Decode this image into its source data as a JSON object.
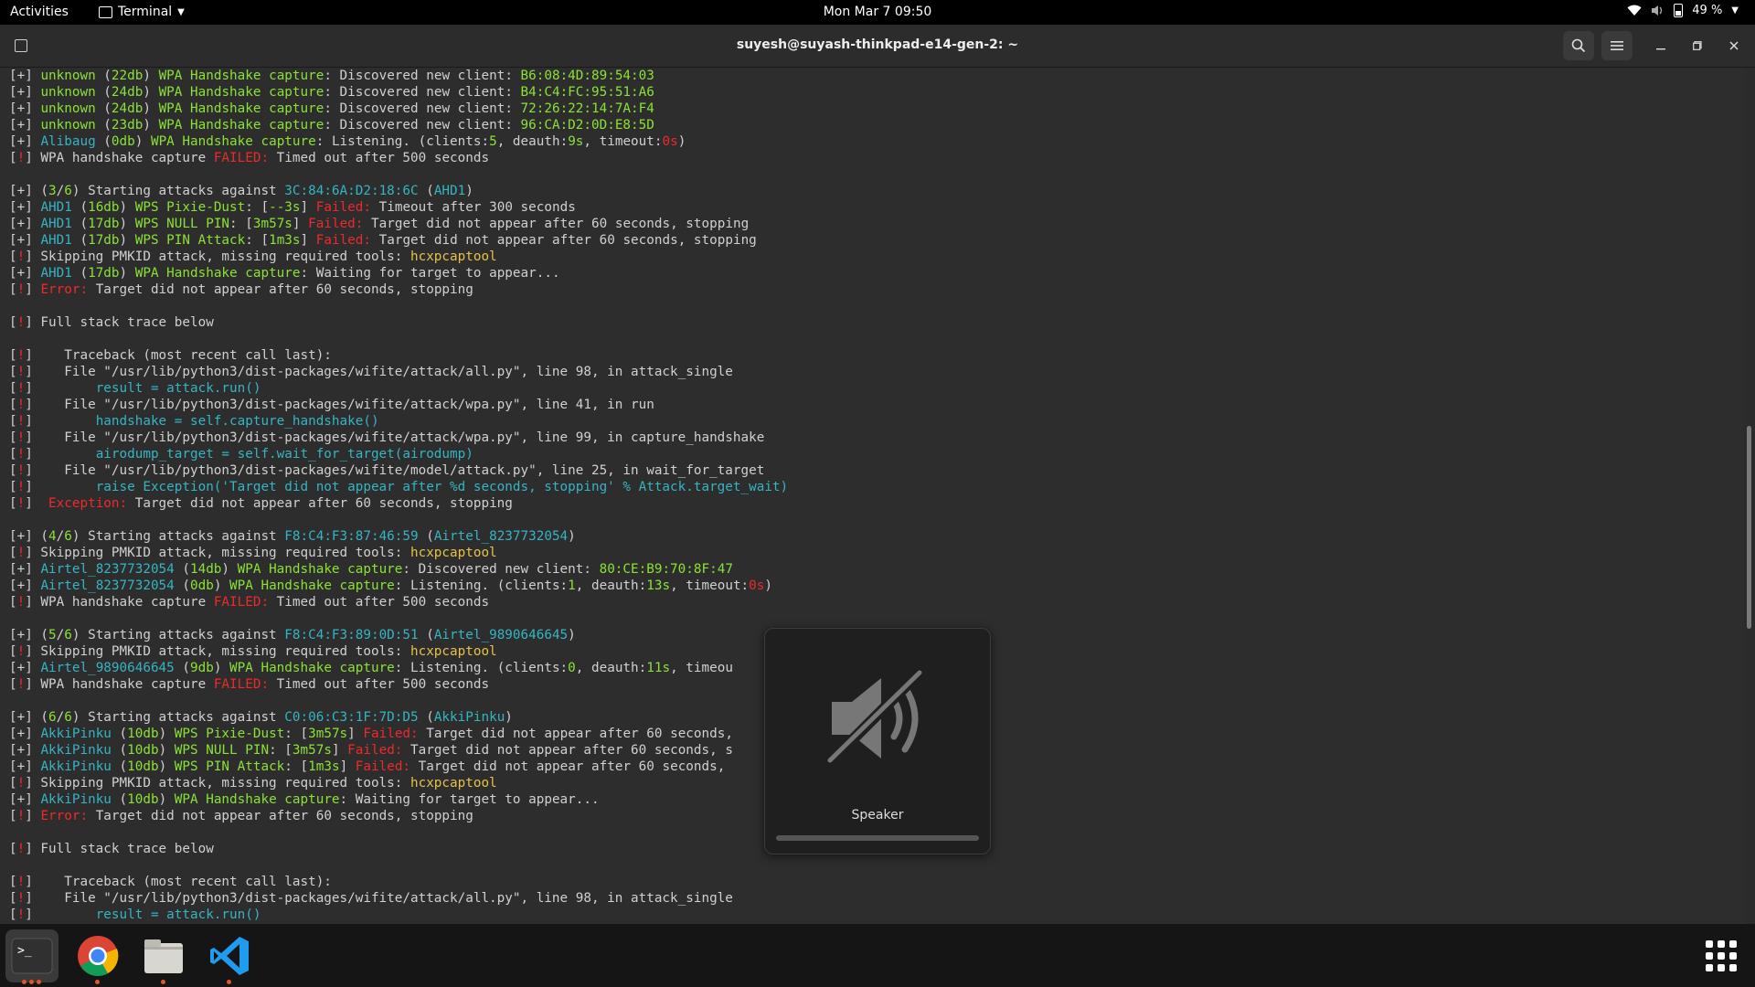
{
  "topbar": {
    "activities": "Activities",
    "app_name": "Terminal",
    "clock": "Mon Mar 7  09:50",
    "battery": "49 %"
  },
  "window": {
    "title": "suyesh@suyash-thinkpad-e14-gen-2: ~"
  },
  "terminal_lines": [
    [
      [
        "w",
        "[+] "
      ],
      [
        "g",
        "unknown"
      ],
      [
        "w",
        " ("
      ],
      [
        "g",
        "22db"
      ],
      [
        "w",
        ") "
      ],
      [
        "g",
        "WPA Handshake capture"
      ],
      [
        "w",
        ": Discovered new client: "
      ],
      [
        "g",
        "B6:08:4D:89:54:03"
      ]
    ],
    [
      [
        "w",
        "[+] "
      ],
      [
        "g",
        "unknown"
      ],
      [
        "w",
        " ("
      ],
      [
        "g",
        "24db"
      ],
      [
        "w",
        ") "
      ],
      [
        "g",
        "WPA Handshake capture"
      ],
      [
        "w",
        ": Discovered new client: "
      ],
      [
        "g",
        "B4:C4:FC:95:51:A6"
      ]
    ],
    [
      [
        "w",
        "[+] "
      ],
      [
        "g",
        "unknown"
      ],
      [
        "w",
        " ("
      ],
      [
        "g",
        "24db"
      ],
      [
        "w",
        ") "
      ],
      [
        "g",
        "WPA Handshake capture"
      ],
      [
        "w",
        ": Discovered new client: "
      ],
      [
        "g",
        "72:26:22:14:7A:F4"
      ]
    ],
    [
      [
        "w",
        "[+] "
      ],
      [
        "g",
        "unknown"
      ],
      [
        "w",
        " ("
      ],
      [
        "g",
        "23db"
      ],
      [
        "w",
        ") "
      ],
      [
        "g",
        "WPA Handshake capture"
      ],
      [
        "w",
        ": Discovered new client: "
      ],
      [
        "g",
        "96:CA:D2:0D:E8:5D"
      ]
    ],
    [
      [
        "w",
        "[+] "
      ],
      [
        "c",
        "Alibaug"
      ],
      [
        "w",
        " ("
      ],
      [
        "g",
        "0db"
      ],
      [
        "w",
        ") "
      ],
      [
        "g",
        "WPA Handshake capture"
      ],
      [
        "w",
        ": Listening. (clients:"
      ],
      [
        "g",
        "5"
      ],
      [
        "w",
        ", deauth:"
      ],
      [
        "g",
        "9s"
      ],
      [
        "w",
        ", timeout:"
      ],
      [
        "r",
        "0s"
      ],
      [
        "w",
        ")"
      ]
    ],
    [
      [
        "w",
        "["
      ],
      [
        "r",
        "!"
      ],
      [
        "w",
        "] WPA handshake capture "
      ],
      [
        "r",
        "FAILED:"
      ],
      [
        "w",
        " Timed out after 500 seconds"
      ]
    ],
    [
      [
        "w",
        ""
      ]
    ],
    [
      [
        "w",
        "[+] ("
      ],
      [
        "g",
        "3"
      ],
      [
        "w",
        "/"
      ],
      [
        "g",
        "6"
      ],
      [
        "w",
        ") Starting attacks against "
      ],
      [
        "c",
        "3C:84:6A:D2:18:6C"
      ],
      [
        "w",
        " ("
      ],
      [
        "c",
        "AHD1"
      ],
      [
        "w",
        ")"
      ]
    ],
    [
      [
        "w",
        "[+] "
      ],
      [
        "c",
        "AHD1"
      ],
      [
        "w",
        " ("
      ],
      [
        "g",
        "16db"
      ],
      [
        "w",
        ") "
      ],
      [
        "g",
        "WPS Pixie-Dust"
      ],
      [
        "w",
        ": ["
      ],
      [
        "g",
        "--3s"
      ],
      [
        "w",
        "] "
      ],
      [
        "r",
        "Failed:"
      ],
      [
        "w",
        " Timeout after 300 seconds"
      ]
    ],
    [
      [
        "w",
        "[+] "
      ],
      [
        "c",
        "AHD1"
      ],
      [
        "w",
        " ("
      ],
      [
        "g",
        "17db"
      ],
      [
        "w",
        ") "
      ],
      [
        "g",
        "WPS NULL PIN"
      ],
      [
        "w",
        ": ["
      ],
      [
        "g",
        "3m57s"
      ],
      [
        "w",
        "] "
      ],
      [
        "r",
        "Failed:"
      ],
      [
        "w",
        " Target did not appear after 60 seconds, stopping"
      ]
    ],
    [
      [
        "w",
        "[+] "
      ],
      [
        "c",
        "AHD1"
      ],
      [
        "w",
        " ("
      ],
      [
        "g",
        "17db"
      ],
      [
        "w",
        ") "
      ],
      [
        "g",
        "WPS PIN Attack"
      ],
      [
        "w",
        ": ["
      ],
      [
        "g",
        "1m3s"
      ],
      [
        "w",
        "] "
      ],
      [
        "r",
        "Failed:"
      ],
      [
        "w",
        " Target did not appear after 60 seconds, stopping"
      ]
    ],
    [
      [
        "w",
        "["
      ],
      [
        "r",
        "!"
      ],
      [
        "w",
        "] Skipping PMKID attack, missing required tools: "
      ],
      [
        "y",
        "hcxpcaptool"
      ]
    ],
    [
      [
        "w",
        "[+] "
      ],
      [
        "c",
        "AHD1"
      ],
      [
        "w",
        " ("
      ],
      [
        "g",
        "17db"
      ],
      [
        "w",
        ") "
      ],
      [
        "g",
        "WPA Handshake capture"
      ],
      [
        "w",
        ": Waiting for target to appear..."
      ]
    ],
    [
      [
        "w",
        "["
      ],
      [
        "r",
        "!"
      ],
      [
        "w",
        "] "
      ],
      [
        "r",
        "Error:"
      ],
      [
        "w",
        " Target did not appear after 60 seconds, stopping"
      ]
    ],
    [
      [
        "w",
        ""
      ]
    ],
    [
      [
        "w",
        "["
      ],
      [
        "r",
        "!"
      ],
      [
        "w",
        "] Full stack trace below"
      ]
    ],
    [
      [
        "w",
        ""
      ]
    ],
    [
      [
        "w",
        "["
      ],
      [
        "r",
        "!"
      ],
      [
        "w",
        "]    Traceback (most recent call last):"
      ]
    ],
    [
      [
        "w",
        "["
      ],
      [
        "r",
        "!"
      ],
      [
        "w",
        "]    File \"/usr/lib/python3/dist-packages/wifite/attack/all.py\", line 98, in attack_single"
      ]
    ],
    [
      [
        "w",
        "["
      ],
      [
        "r",
        "!"
      ],
      [
        "w",
        "]        "
      ],
      [
        "c",
        "result = attack.run()"
      ]
    ],
    [
      [
        "w",
        "["
      ],
      [
        "r",
        "!"
      ],
      [
        "w",
        "]    File \"/usr/lib/python3/dist-packages/wifite/attack/wpa.py\", line 41, in run"
      ]
    ],
    [
      [
        "w",
        "["
      ],
      [
        "r",
        "!"
      ],
      [
        "w",
        "]        "
      ],
      [
        "c",
        "handshake = self.capture_handshake()"
      ]
    ],
    [
      [
        "w",
        "["
      ],
      [
        "r",
        "!"
      ],
      [
        "w",
        "]    File \"/usr/lib/python3/dist-packages/wifite/attack/wpa.py\", line 99, in capture_handshake"
      ]
    ],
    [
      [
        "w",
        "["
      ],
      [
        "r",
        "!"
      ],
      [
        "w",
        "]        "
      ],
      [
        "c",
        "airodump_target = self.wait_for_target(airodump)"
      ]
    ],
    [
      [
        "w",
        "["
      ],
      [
        "r",
        "!"
      ],
      [
        "w",
        "]    File \"/usr/lib/python3/dist-packages/wifite/model/attack.py\", line 25, in wait_for_target"
      ]
    ],
    [
      [
        "w",
        "["
      ],
      [
        "r",
        "!"
      ],
      [
        "w",
        "]        "
      ],
      [
        "c",
        "raise Exception('Target did not appear after %d seconds, stopping' % Attack.target_wait)"
      ]
    ],
    [
      [
        "w",
        "["
      ],
      [
        "r",
        "!"
      ],
      [
        "w",
        "] "
      ],
      [
        "r",
        " Exception:"
      ],
      [
        "w",
        " Target did not appear after 60 seconds, stopping"
      ]
    ],
    [
      [
        "w",
        ""
      ]
    ],
    [
      [
        "w",
        "[+] ("
      ],
      [
        "g",
        "4"
      ],
      [
        "w",
        "/"
      ],
      [
        "g",
        "6"
      ],
      [
        "w",
        ") Starting attacks against "
      ],
      [
        "c",
        "F8:C4:F3:87:46:59"
      ],
      [
        "w",
        " ("
      ],
      [
        "c",
        "Airtel_8237732054"
      ],
      [
        "w",
        ")"
      ]
    ],
    [
      [
        "w",
        "["
      ],
      [
        "r",
        "!"
      ],
      [
        "w",
        "] Skipping PMKID attack, missing required tools: "
      ],
      [
        "y",
        "hcxpcaptool"
      ]
    ],
    [
      [
        "w",
        "[+] "
      ],
      [
        "c",
        "Airtel_8237732054"
      ],
      [
        "w",
        " ("
      ],
      [
        "g",
        "14db"
      ],
      [
        "w",
        ") "
      ],
      [
        "g",
        "WPA Handshake capture"
      ],
      [
        "w",
        ": Discovered new client: "
      ],
      [
        "g",
        "80:CE:B9:70:8F:47"
      ]
    ],
    [
      [
        "w",
        "[+] "
      ],
      [
        "c",
        "Airtel_8237732054"
      ],
      [
        "w",
        " ("
      ],
      [
        "g",
        "0db"
      ],
      [
        "w",
        ") "
      ],
      [
        "g",
        "WPA Handshake capture"
      ],
      [
        "w",
        ": Listening. (clients:"
      ],
      [
        "g",
        "1"
      ],
      [
        "w",
        ", deauth:"
      ],
      [
        "g",
        "13s"
      ],
      [
        "w",
        ", timeout:"
      ],
      [
        "r",
        "0s"
      ],
      [
        "w",
        ")"
      ]
    ],
    [
      [
        "w",
        "["
      ],
      [
        "r",
        "!"
      ],
      [
        "w",
        "] WPA handshake capture "
      ],
      [
        "r",
        "FAILED:"
      ],
      [
        "w",
        " Timed out after 500 seconds"
      ]
    ],
    [
      [
        "w",
        ""
      ]
    ],
    [
      [
        "w",
        "[+] ("
      ],
      [
        "g",
        "5"
      ],
      [
        "w",
        "/"
      ],
      [
        "g",
        "6"
      ],
      [
        "w",
        ") Starting attacks against "
      ],
      [
        "c",
        "F8:C4:F3:89:0D:51"
      ],
      [
        "w",
        " ("
      ],
      [
        "c",
        "Airtel_9890646645"
      ],
      [
        "w",
        ")"
      ]
    ],
    [
      [
        "w",
        "["
      ],
      [
        "r",
        "!"
      ],
      [
        "w",
        "] Skipping PMKID attack, missing required tools: "
      ],
      [
        "y",
        "hcxpcaptool"
      ]
    ],
    [
      [
        "w",
        "[+] "
      ],
      [
        "c",
        "Airtel_9890646645"
      ],
      [
        "w",
        " ("
      ],
      [
        "g",
        "9db"
      ],
      [
        "w",
        ") "
      ],
      [
        "g",
        "WPA Handshake capture"
      ],
      [
        "w",
        ": Listening. (clients:"
      ],
      [
        "g",
        "0"
      ],
      [
        "w",
        ", deauth:"
      ],
      [
        "g",
        "11s"
      ],
      [
        "w",
        ", timeou"
      ]
    ],
    [
      [
        "w",
        "["
      ],
      [
        "r",
        "!"
      ],
      [
        "w",
        "] WPA handshake capture "
      ],
      [
        "r",
        "FAILED:"
      ],
      [
        "w",
        " Timed out after 500 seconds"
      ]
    ],
    [
      [
        "w",
        ""
      ]
    ],
    [
      [
        "w",
        "[+] ("
      ],
      [
        "g",
        "6"
      ],
      [
        "w",
        "/"
      ],
      [
        "g",
        "6"
      ],
      [
        "w",
        ") Starting attacks against "
      ],
      [
        "c",
        "C0:06:C3:1F:7D:D5"
      ],
      [
        "w",
        " ("
      ],
      [
        "c",
        "AkkiPinku"
      ],
      [
        "w",
        ")"
      ]
    ],
    [
      [
        "w",
        "[+] "
      ],
      [
        "c",
        "AkkiPinku"
      ],
      [
        "w",
        " ("
      ],
      [
        "g",
        "10db"
      ],
      [
        "w",
        ") "
      ],
      [
        "g",
        "WPS Pixie-Dust"
      ],
      [
        "w",
        ": ["
      ],
      [
        "g",
        "3m57s"
      ],
      [
        "w",
        "] "
      ],
      [
        "r",
        "Failed:"
      ],
      [
        "w",
        " Target did not appear after 60 seconds,"
      ]
    ],
    [
      [
        "w",
        "[+] "
      ],
      [
        "c",
        "AkkiPinku"
      ],
      [
        "w",
        " ("
      ],
      [
        "g",
        "10db"
      ],
      [
        "w",
        ") "
      ],
      [
        "g",
        "WPS NULL PIN"
      ],
      [
        "w",
        ": ["
      ],
      [
        "g",
        "3m57s"
      ],
      [
        "w",
        "] "
      ],
      [
        "r",
        "Failed:"
      ],
      [
        "w",
        " Target did not appear after 60 seconds, s"
      ]
    ],
    [
      [
        "w",
        "[+] "
      ],
      [
        "c",
        "AkkiPinku"
      ],
      [
        "w",
        " ("
      ],
      [
        "g",
        "10db"
      ],
      [
        "w",
        ") "
      ],
      [
        "g",
        "WPS PIN Attack"
      ],
      [
        "w",
        ": ["
      ],
      [
        "g",
        "1m3s"
      ],
      [
        "w",
        "] "
      ],
      [
        "r",
        "Failed:"
      ],
      [
        "w",
        " Target did not appear after 60 seconds,"
      ]
    ],
    [
      [
        "w",
        "["
      ],
      [
        "r",
        "!"
      ],
      [
        "w",
        "] Skipping PMKID attack, missing required tools: "
      ],
      [
        "y",
        "hcxpcaptool"
      ]
    ],
    [
      [
        "w",
        "[+] "
      ],
      [
        "c",
        "AkkiPinku"
      ],
      [
        "w",
        " ("
      ],
      [
        "g",
        "10db"
      ],
      [
        "w",
        ") "
      ],
      [
        "g",
        "WPA Handshake capture"
      ],
      [
        "w",
        ": Waiting for target to appear..."
      ]
    ],
    [
      [
        "w",
        "["
      ],
      [
        "r",
        "!"
      ],
      [
        "w",
        "] "
      ],
      [
        "r",
        "Error:"
      ],
      [
        "w",
        " Target did not appear after 60 seconds, stopping"
      ]
    ],
    [
      [
        "w",
        ""
      ]
    ],
    [
      [
        "w",
        "["
      ],
      [
        "r",
        "!"
      ],
      [
        "w",
        "] Full stack trace below"
      ]
    ],
    [
      [
        "w",
        ""
      ]
    ],
    [
      [
        "w",
        "["
      ],
      [
        "r",
        "!"
      ],
      [
        "w",
        "]    Traceback (most recent call last):"
      ]
    ],
    [
      [
        "w",
        "["
      ],
      [
        "r",
        "!"
      ],
      [
        "w",
        "]    File \"/usr/lib/python3/dist-packages/wifite/attack/all.py\", line 98, in attack_single"
      ]
    ],
    [
      [
        "w",
        "["
      ],
      [
        "r",
        "!"
      ],
      [
        "w",
        "]        "
      ],
      [
        "c",
        "result = attack.run()"
      ]
    ]
  ],
  "osd": {
    "label": "Speaker",
    "icon": "speaker-muted-icon",
    "volume": 0
  },
  "dock": {
    "items": [
      {
        "name": "terminal",
        "icon": "terminal-icon",
        "active": true
      },
      {
        "name": "chrome",
        "icon": "chrome-icon",
        "active": false
      },
      {
        "name": "files",
        "icon": "files-icon",
        "active": false
      },
      {
        "name": "vscode",
        "icon": "vscode-icon",
        "active": false
      }
    ],
    "show_apps_icon": "app-grid-icon"
  },
  "colors": {
    "white": "#d0d0d0",
    "green": "#8ae234",
    "cyan": "#34b5c2",
    "yellow": "#e5c24a",
    "red": "#ef2929",
    "accent": "#e95420"
  }
}
